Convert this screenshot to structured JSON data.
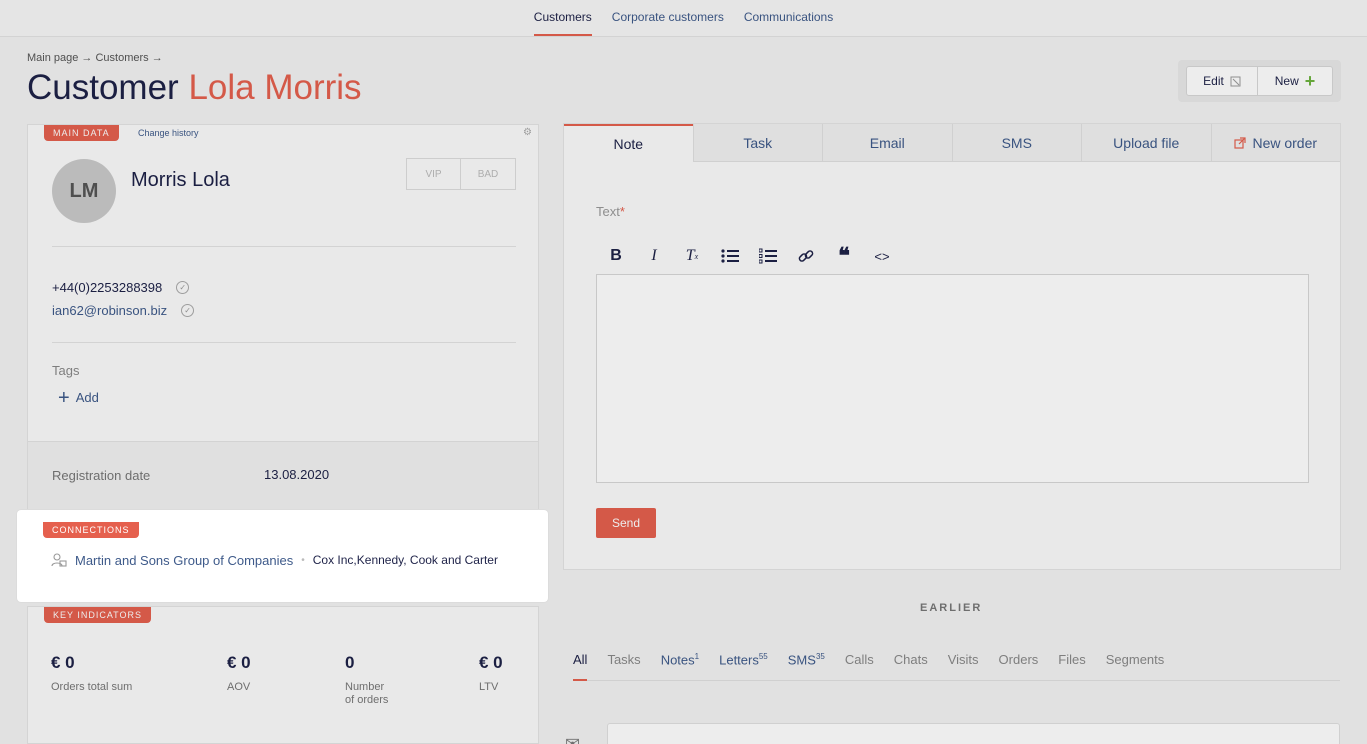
{
  "topnav": {
    "customers": "Customers",
    "corporate": "Corporate customers",
    "communications": "Communications"
  },
  "breadcrumb": "Main page → Customers →",
  "title": {
    "prefix": "Customer",
    "name": "Lola Morris"
  },
  "actions": {
    "edit": "Edit",
    "new": "New"
  },
  "main_data": {
    "label": "MAIN DATA",
    "change_history": "Change history",
    "initials": "LM",
    "name": "Morris Lola",
    "vip": "VIP",
    "bad": "BAD",
    "phone": "+44(0)2253288398",
    "email": "ian62@robinson.biz",
    "tags_label": "Tags",
    "add_label": "Add",
    "reg_label": "Registration date",
    "reg_value": "13.08.2020"
  },
  "connections": {
    "label": "CONNECTIONS",
    "company": "Martin and Sons Group of Companies",
    "others": "Cox Inc,Kennedy, Cook and Carter"
  },
  "key_indicators": {
    "label": "KEY INDICATORS",
    "items": [
      {
        "value": "€ 0",
        "label": "Orders total sum"
      },
      {
        "value": "€ 0",
        "label": "AOV"
      },
      {
        "value": "0",
        "label": "Number of orders"
      },
      {
        "value": "€ 0",
        "label": "LTV"
      }
    ]
  },
  "editor": {
    "tabs": [
      "Note",
      "Task",
      "Email",
      "SMS",
      "Upload file",
      "New order"
    ],
    "text_label": "Text",
    "send": "Send"
  },
  "earlier": "EARLIER",
  "filters": {
    "all": "All",
    "tasks": "Tasks",
    "notes": "Notes",
    "notes_count": "1",
    "letters": "Letters",
    "letters_count": "55",
    "sms": "SMS",
    "sms_count": "35",
    "calls": "Calls",
    "chats": "Chats",
    "visits": "Visits",
    "orders": "Orders",
    "files": "Files",
    "segments": "Segments"
  },
  "colors": {
    "accent": "#e5604e",
    "link": "#3e5a8a",
    "text": "#1e2248"
  }
}
